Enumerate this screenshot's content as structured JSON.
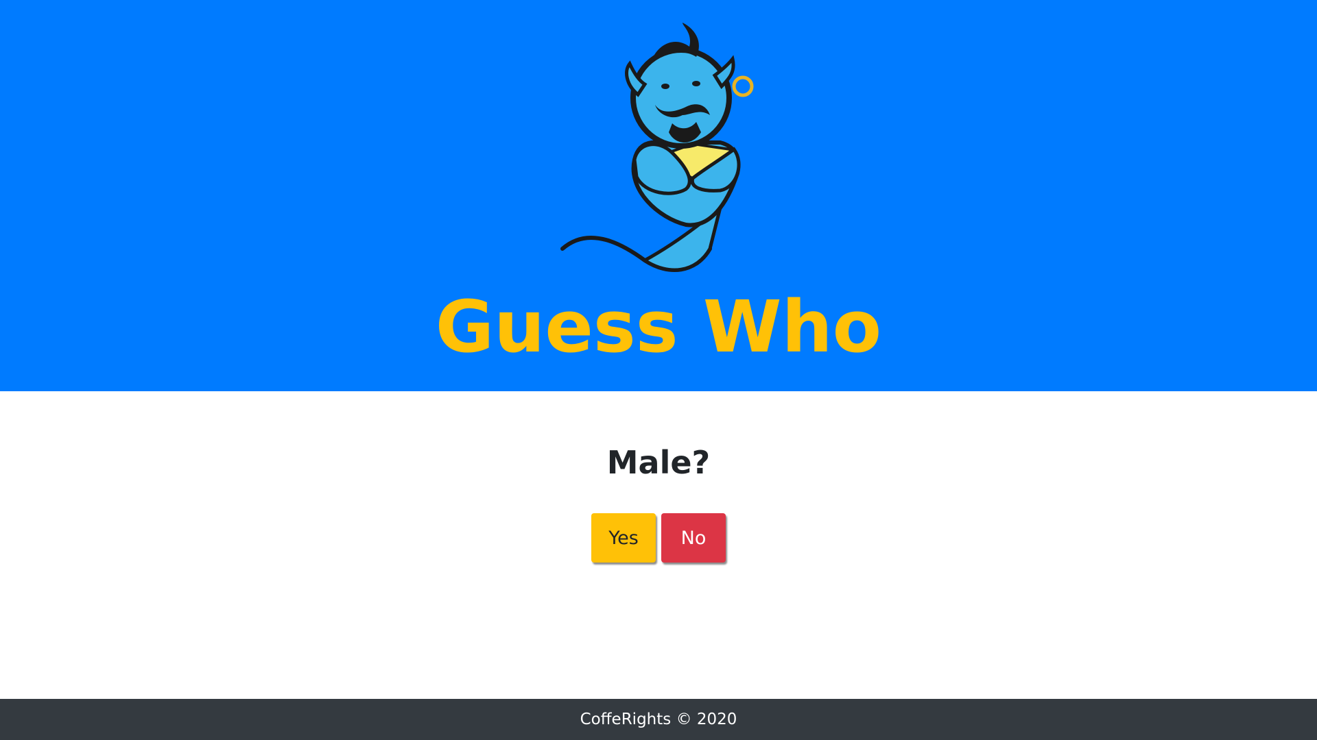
{
  "header": {
    "title": "Guess Who",
    "logo_icon": "genie-mascot-icon",
    "background_color": "#007bff",
    "title_color": "#ffc107"
  },
  "game": {
    "question": "Male?",
    "yes_label": "Yes",
    "no_label": "No",
    "yes_color": "#ffc107",
    "no_color": "#dc3545"
  },
  "footer": {
    "text": "CoffeRights © 2020",
    "background_color": "#343a40"
  }
}
